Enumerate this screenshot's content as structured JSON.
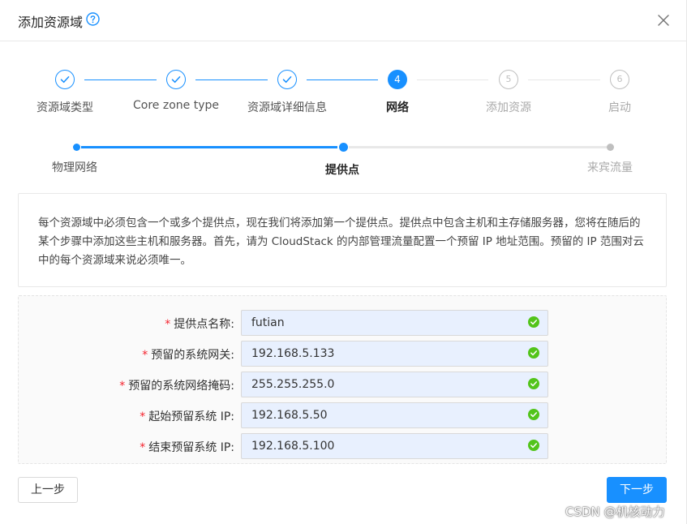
{
  "dialog": {
    "title": "添加资源域",
    "help_icon": "question-circle-icon",
    "close_icon": "close-icon"
  },
  "steps": [
    {
      "number": "1",
      "label": "资源域类型",
      "status": "done"
    },
    {
      "number": "2",
      "label": "Core zone type",
      "status": "done"
    },
    {
      "number": "3",
      "label": "资源域详细信息",
      "status": "done"
    },
    {
      "number": "4",
      "label": "网络",
      "status": "active"
    },
    {
      "number": "5",
      "label": "添加资源",
      "status": "wait"
    },
    {
      "number": "6",
      "label": "启动",
      "status": "wait"
    }
  ],
  "substeps": [
    {
      "label": "物理网络",
      "status": "done"
    },
    {
      "label": "提供点",
      "status": "active"
    },
    {
      "label": "来宾流量",
      "status": "wait"
    }
  ],
  "description": "每个资源域中必须包含一个或多个提供点，现在我们将添加第一个提供点。提供点中包含主机和主存储服务器，您将在随后的某个步骤中添加这些主机和服务器。首先，请为 CloudStack 的内部管理流量配置一个预留 IP 地址范围。预留的 IP 范围对云中的每个资源域来说必须唯一。",
  "form": {
    "required_mark": "*",
    "fields": [
      {
        "label": "提供点名称:",
        "value": "futian"
      },
      {
        "label": "预留的系统网关:",
        "value": "192.168.5.133"
      },
      {
        "label": "预留的系统网络掩码:",
        "value": "255.255.255.0"
      },
      {
        "label": "起始预留系统 IP:",
        "value": "192.168.5.50"
      },
      {
        "label": "结束预留系统 IP:",
        "value": "192.168.5.100"
      }
    ]
  },
  "buttons": {
    "prev": "上一步",
    "next": "下一步"
  },
  "watermark": "CSDN @机核动力",
  "colors": {
    "primary": "#1890ff",
    "success": "#52c41a",
    "required": "#f5222d",
    "input_bg": "#e8f0fe"
  }
}
